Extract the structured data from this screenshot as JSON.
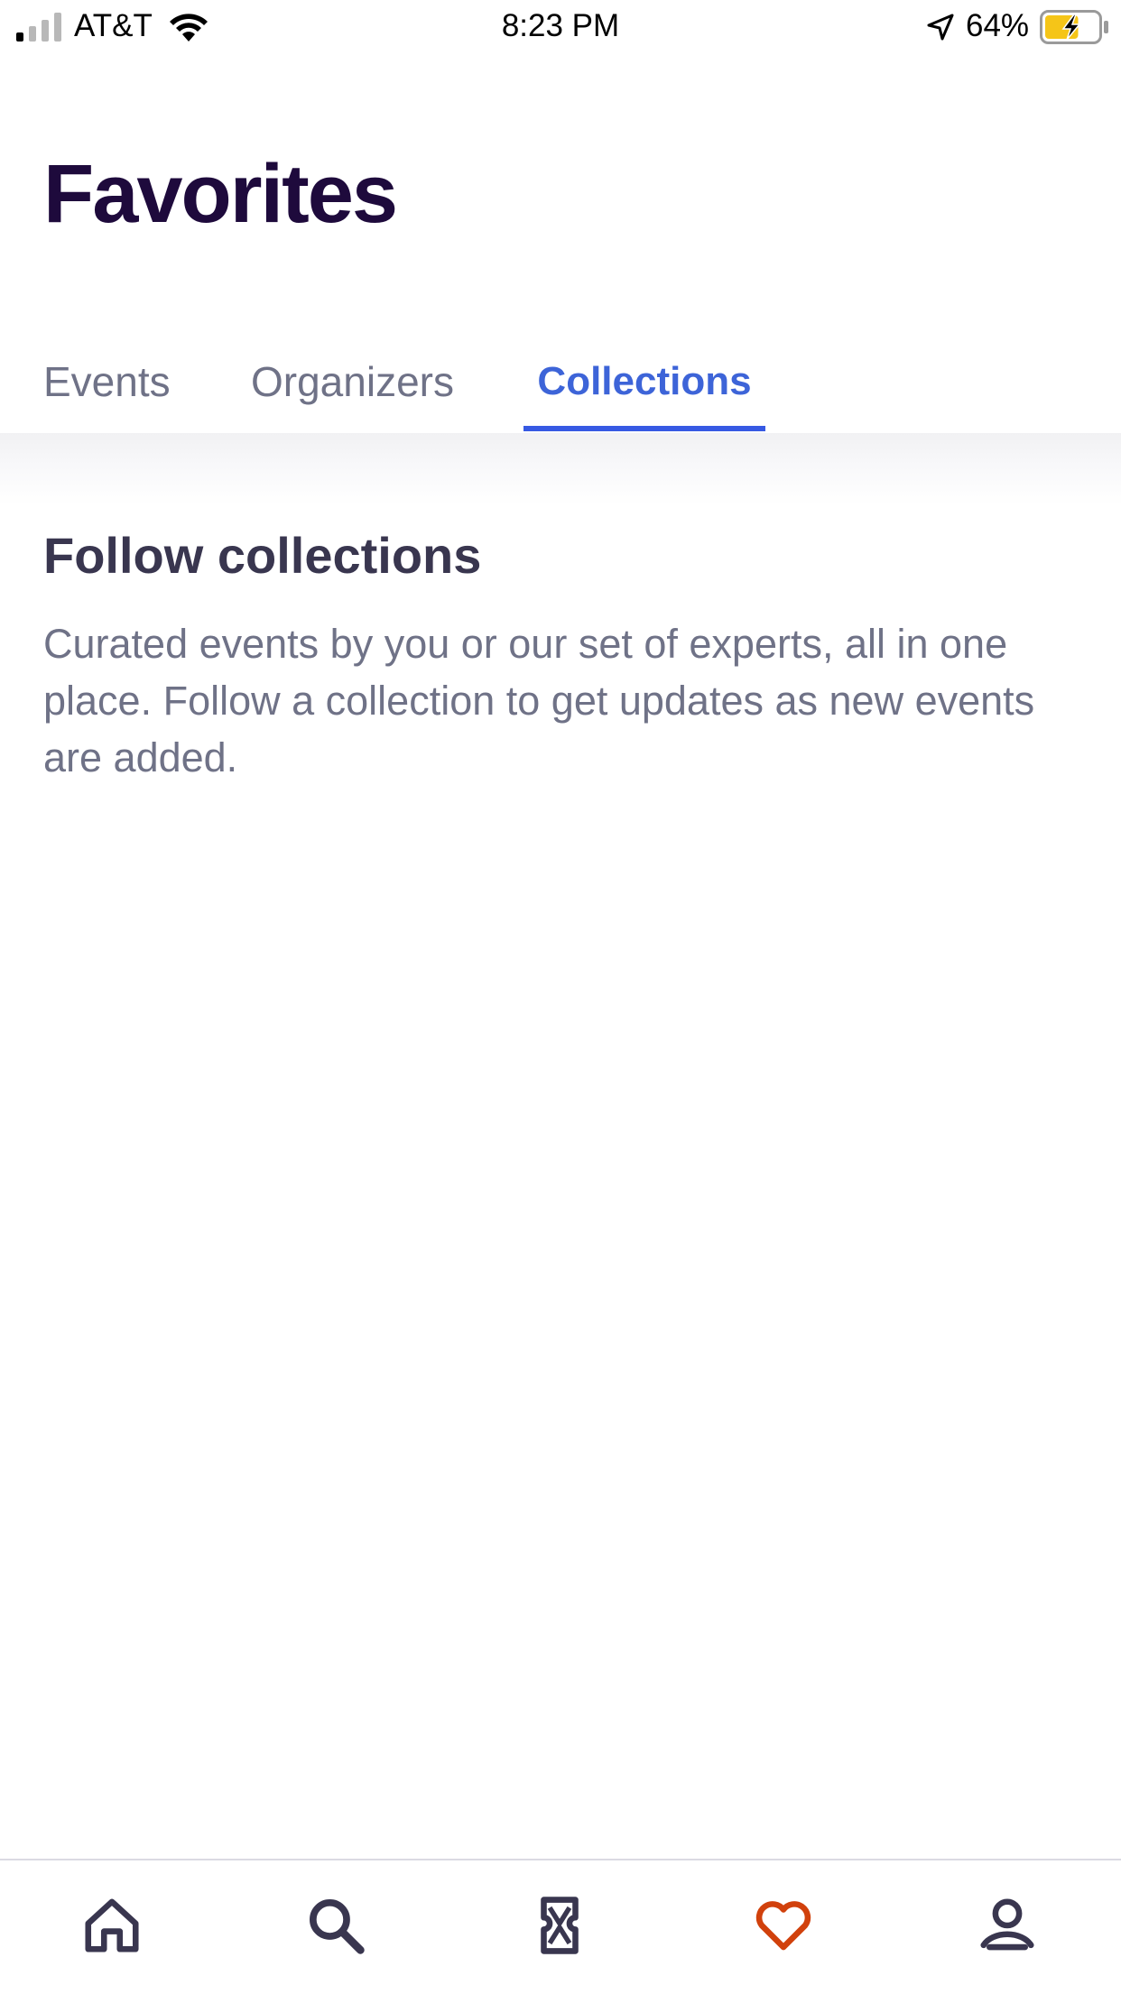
{
  "status_bar": {
    "carrier": "AT&T",
    "time": "8:23 PM",
    "battery_percent": "64%",
    "battery_level": 0.64,
    "signal_bars_active": 1,
    "signal_bars_total": 4,
    "icons": [
      "signal-icon",
      "wifi-icon",
      "location-arrow-icon",
      "battery-charging-icon"
    ]
  },
  "header": {
    "title": "Favorites"
  },
  "tabs": [
    {
      "label": "Events",
      "active": false
    },
    {
      "label": "Organizers",
      "active": false
    },
    {
      "label": "Collections",
      "active": true
    }
  ],
  "content": {
    "heading": "Follow collections",
    "body": "Curated events by you or our set of experts, all in one place. Follow a collection to get updates as new events are added."
  },
  "bottom_nav": {
    "items": [
      {
        "icon": "home-icon",
        "active": false
      },
      {
        "icon": "search-icon",
        "active": false
      },
      {
        "icon": "ticket-icon",
        "active": false
      },
      {
        "icon": "heart-icon",
        "active": true
      },
      {
        "icon": "profile-icon",
        "active": false
      }
    ]
  },
  "colors": {
    "title": "#1e0a3c",
    "active_tab": "#3d64d8",
    "active_underline": "#3659e3",
    "inactive_text": "#6f7287",
    "heading": "#39364f",
    "nav_icon": "#39364f",
    "nav_active": "#d1410c",
    "battery_fill": "#f5c518"
  }
}
